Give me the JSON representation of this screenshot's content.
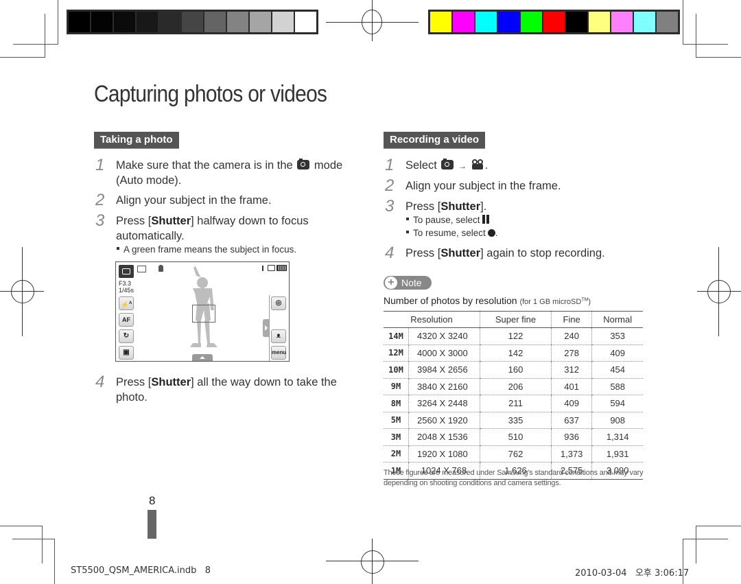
{
  "calibration": {
    "grayscale": [
      "#000000",
      "#030303",
      "#0b0b0b",
      "#181818",
      "#2a2a2a",
      "#454545",
      "#646464",
      "#838383",
      "#a5a5a5",
      "#d2d2d2",
      "#ffffff"
    ],
    "color": [
      "#ffff00",
      "#ff00ff",
      "#00ffff",
      "#0000ff",
      "#00ff00",
      "#ff0000",
      "#000000",
      "#ffff80",
      "#ff80ff",
      "#80ffff",
      "#808080"
    ]
  },
  "page": {
    "title": "Capturing photos or videos",
    "page_number": "8"
  },
  "photo_section": {
    "heading": "Taking a photo",
    "steps": [
      {
        "num": "1",
        "text_a": "Make sure that the camera is in the",
        "icon": "camera-icon",
        "text_b": "mode",
        "text_c": "(Auto mode)."
      },
      {
        "num": "2",
        "text": "Align your subject in the frame."
      },
      {
        "num": "3",
        "text_a": "Press [",
        "bold": "Shutter",
        "text_b": "] halfway down to focus",
        "text_c": "automatically."
      },
      {
        "num": "4",
        "text_a": "Press [",
        "bold": "Shutter",
        "text_b": "] all the way down to take the",
        "text_c": "photo."
      }
    ],
    "bullet": "A green frame means the subject in focus.",
    "screen": {
      "aperture": "F3.3",
      "shutter_speed": "1/45s",
      "left_buttons": [
        "flash-auto",
        "autofocus",
        "timer-off",
        "display"
      ],
      "right_buttons": [
        "smart-filter",
        "dual-is",
        "menu"
      ],
      "menu_label": "menu",
      "af_label": "AF",
      "flash_label": "A"
    }
  },
  "video_section": {
    "heading": "Recording a video",
    "steps": [
      {
        "num": "1",
        "text_a": "Select",
        "arrow": "→",
        "text_b": "."
      },
      {
        "num": "2",
        "text": "Align your subject in the frame."
      },
      {
        "num": "3",
        "text_a": "Press [",
        "bold": "Shutter",
        "text_b": "]."
      },
      {
        "num": "4",
        "text_a": "Press [",
        "bold": "Shutter",
        "text_b": "] again to stop recording."
      }
    ],
    "bullets": [
      {
        "text": "To pause, select",
        "end": "."
      },
      {
        "text": "To resume, select",
        "end": "."
      }
    ]
  },
  "note": {
    "label": "Note",
    "table_title": "Number of photos by resolution",
    "table_subtitle": "(for 1 GB microSD",
    "table_subtitle_tm": "TM",
    "table_subtitle_end": ")",
    "columns": [
      "Resolution",
      "Super fine",
      "Fine",
      "Normal"
    ],
    "rows": [
      {
        "icon": "14M",
        "resolution": "4320 X 3240",
        "super_fine": "122",
        "fine": "240",
        "normal": "353"
      },
      {
        "icon": "12M",
        "resolution": "4000 X 3000",
        "super_fine": "142",
        "fine": "278",
        "normal": "409"
      },
      {
        "icon": "10M",
        "resolution": "3984 X 2656",
        "super_fine": "160",
        "fine": "312",
        "normal": "454"
      },
      {
        "icon": "9M",
        "resolution": "3840 X 2160",
        "super_fine": "206",
        "fine": "401",
        "normal": "588"
      },
      {
        "icon": "8M",
        "resolution": "3264 X 2448",
        "super_fine": "211",
        "fine": "409",
        "normal": "594"
      },
      {
        "icon": "5M",
        "resolution": "2560 X 1920",
        "super_fine": "335",
        "fine": "637",
        "normal": "908"
      },
      {
        "icon": "3M",
        "resolution": "2048 X 1536",
        "super_fine": "510",
        "fine": "936",
        "normal": "1,314"
      },
      {
        "icon": "2M",
        "resolution": "1920 X 1080",
        "super_fine": "762",
        "fine": "1,373",
        "normal": "1,931"
      },
      {
        "icon": "1M",
        "resolution": "1024 X 768",
        "super_fine": "1,626",
        "fine": "2,575",
        "normal": "3,090"
      }
    ],
    "footnote": "These figures are measured under Samsung's standard conditions and may vary depending on shooting conditions and camera settings."
  },
  "slug": {
    "file": "ST5500_QSM_AMERICA.indb   8",
    "timestamp": "2010-03-04   오후 3:06:17"
  }
}
